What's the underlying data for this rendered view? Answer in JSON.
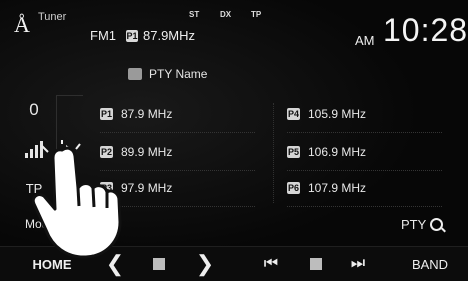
{
  "status": {
    "logo": "Å",
    "source": "Tuner",
    "band": "FM1",
    "preset_chip": "P1",
    "frequency": "87.9MHz",
    "indicators": [
      "ST",
      "DX",
      "TP"
    ],
    "am": "AM",
    "clock": "10:28"
  },
  "pty_name": "PTY Name",
  "side": {
    "zero": "0",
    "tp": "TP"
  },
  "presets": [
    {
      "num": "P1",
      "freq": "87.9 MHz"
    },
    {
      "num": "P2",
      "freq": "89.9 MHz"
    },
    {
      "num": "P3",
      "freq": "97.9 MHz"
    },
    {
      "num": "P4",
      "freq": "105.9 MHz"
    },
    {
      "num": "P5",
      "freq": "106.9 MHz"
    },
    {
      "num": "P6",
      "freq": "107.9 MHz"
    }
  ],
  "buttons": {
    "mode": "Mode",
    "pty": "PTY",
    "home": "HOME",
    "band": "BAND"
  },
  "icons": {
    "prev": "chevron-left-icon",
    "stop": "stop-square-icon",
    "next": "chevron-right-icon",
    "skip_back": "skip-back-icon",
    "skip_fwd": "skip-forward-icon",
    "search": "search-icon",
    "hand": "hand-tap-icon"
  },
  "colors": {
    "background": "#070707",
    "text": "#e9e9e9",
    "chip": "#d5d5d5"
  }
}
